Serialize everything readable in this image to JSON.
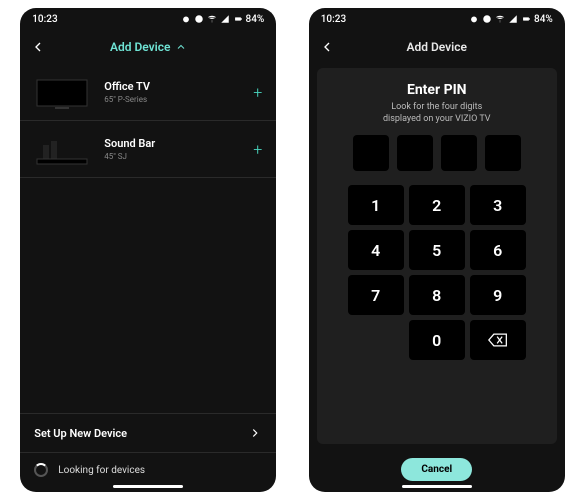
{
  "status": {
    "time": "10:23",
    "battery": "84%"
  },
  "screen1": {
    "header_title": "Add Device",
    "devices": [
      {
        "name": "Office TV",
        "subtitle": "65\" P-Series"
      },
      {
        "name": "Sound Bar",
        "subtitle": "45\" SJ"
      }
    ],
    "setup_label": "Set Up New Device",
    "looking_label": "Looking for devices"
  },
  "screen2": {
    "header_title": "Add Device",
    "pin_title": "Enter PIN",
    "pin_subtitle": "Look for the four digits\ndisplayed on your VIZIO TV",
    "keys": [
      "1",
      "2",
      "3",
      "4",
      "5",
      "6",
      "7",
      "8",
      "9",
      "0"
    ],
    "cancel_label": "Cancel"
  }
}
